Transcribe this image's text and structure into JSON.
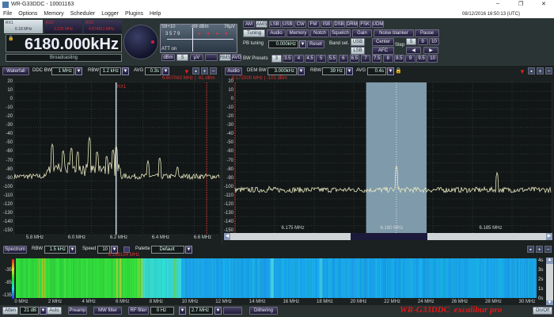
{
  "window": {
    "title": "WR-G33DDC - 10001163",
    "datetime": "08/12/2016 16:50:13 (UTC)",
    "minimize": "–",
    "restore": "❐",
    "close": "✕"
  },
  "menu": [
    "File",
    "Options",
    "Memory",
    "Scheduler",
    "Logger",
    "Plugins",
    "Help"
  ],
  "receivers": [
    {
      "label": "RX1",
      "freq": "6.18 MHz"
    },
    {
      "label": "RX2",
      "freq": "3.225 MHz"
    },
    {
      "label": "RX3",
      "freq": "4.874611 MHz"
    }
  ],
  "frequency_display": "6180.000kHz",
  "station_label": "Broadcasting",
  "smeter": {
    "left": "S9+10",
    "center": "-69 dBm",
    "right": "76µV",
    "scale": "3 5 7 9",
    "att": "ATT on",
    "units": [
      "dBm",
      "S",
      "µV",
      "",
      "RMS",
      "AVG"
    ],
    "active_units": [
      "S",
      "RMS"
    ]
  },
  "modes": [
    "AM",
    "AMS",
    "LSB",
    "USB",
    "CW",
    "FM",
    "ISB",
    "DSB",
    "DRM",
    "FSK",
    "UDM"
  ],
  "active_mode": "AMS",
  "tabs": [
    "Tuning",
    "Audio",
    "Memory",
    "Notch",
    "Squelch",
    "Gain",
    "Noise blanker",
    "Pause"
  ],
  "active_tab": "Tuning",
  "tuning": {
    "pb_label": "PB tuning",
    "pb_value": "0.000kHz",
    "reset": "Reset",
    "band_sel": "Band sel.",
    "usb": "USB",
    "lsb": "LSB",
    "center": "Center",
    "afc": "AFC",
    "step_label": "Step",
    "steps": [
      "5",
      "9",
      "10"
    ],
    "active_step": "5",
    "bw_label": "BW Presets",
    "bw_presets": [
      "3",
      "3.5",
      "4",
      "4.5",
      "5",
      "5.5",
      "6",
      "6.5",
      "7",
      "7.5",
      "8",
      "8.5",
      "9",
      "9.5",
      "10"
    ],
    "active_bw": "3"
  },
  "ddc_panel": {
    "button": "Waterfall",
    "ddc_bw_label": "DDC BW",
    "ddc_bw": "1 MHz",
    "rbw_label": "RBW",
    "rbw": "1.2 kHz",
    "avg_label": "AVG",
    "avg": "0.3s",
    "cursor_readout": "6.607083 MHz | -91 dBm",
    "marker": "RX1",
    "y_ticks": [
      "20",
      "10",
      "0",
      "-10",
      "-20",
      "-30",
      "-40",
      "-50",
      "-60",
      "-70",
      "-80",
      "-90",
      "-100",
      "-110",
      "-120",
      "-130",
      "-140",
      "-150"
    ],
    "x_ticks": [
      "5.8 MHz",
      "6.0 MHz",
      "6.2 MHz",
      "6.4 MHz",
      "6.6 MHz"
    ]
  },
  "audio_panel": {
    "button": "Audio",
    "dem_bw_label": "DEM BW",
    "dem_bw": "3.000kHz",
    "rbw_label": "RBW",
    "rbw": "39 Hz",
    "avg_label": "AVG",
    "avg": "0.4s",
    "cursor_readout": "6.172000 MHz | -101 dBm",
    "x_ticks": [
      "6.175 MHz",
      "6.180 MHz",
      "6.185 MHz"
    ]
  },
  "waterfall": {
    "button": "Spectrum",
    "rbw_label": "RBW",
    "rbw": "1.5 kHz",
    "speed_label": "Speed",
    "speed": "10",
    "palette_label": "Palette",
    "palette": "Default",
    "cursor_readout": "6.169154 MHz",
    "y_ticks": [
      "-35",
      "-85",
      "-135"
    ],
    "time_ticks": [
      "4s",
      "3s",
      "2s",
      "1s",
      "0s"
    ],
    "x_ticks": [
      "0 MHz",
      "2 MHz",
      "4 MHz",
      "6 MHz",
      "8 MHz",
      "10 MHz",
      "12 MHz",
      "14 MHz",
      "16 MHz",
      "18 MHz",
      "20 MHz",
      "22 MHz",
      "24 MHz",
      "26 MHz",
      "28 MHz",
      "30 MHz"
    ]
  },
  "bottom": {
    "atten": "Atten",
    "atten_value": "21 dB",
    "auto": "Auto",
    "preamp": "Preamp",
    "mw_filter": "MW filter",
    "rf_filter": "RF filter",
    "rf_lo": "0 Hz",
    "rf_hi": "2.7 MHz",
    "dithering": "Dithering",
    "logo": "WR-G33DDC  excalibur pro",
    "onoff": "On/Off"
  },
  "chart_data": [
    {
      "type": "line",
      "title": "",
      "xlim": [
        5.7,
        6.67
      ],
      "ylim": [
        -150,
        20
      ],
      "noise_floor_dbm": -85,
      "peaks": [
        {
          "x": 5.88,
          "y": -48
        },
        {
          "x": 5.93,
          "y": -55
        },
        {
          "x": 5.97,
          "y": -52
        },
        {
          "x": 6.0,
          "y": -56
        },
        {
          "x": 6.055,
          "y": -41
        },
        {
          "x": 6.09,
          "y": -56
        },
        {
          "x": 6.135,
          "y": -61
        },
        {
          "x": 6.165,
          "y": -54
        },
        {
          "x": 6.18,
          "y": -50
        },
        {
          "x": 6.33,
          "y": -67
        },
        {
          "x": 6.385,
          "y": -63
        },
        {
          "x": 6.47,
          "y": -73
        }
      ],
      "color": "#e8e8c0"
    },
    {
      "type": "line",
      "title": "",
      "xlim": [
        6.172,
        6.1877
      ],
      "ylim": [
        -150,
        20
      ],
      "noise_floor_dbm": -100,
      "peaks": [
        {
          "x": 6.1737,
          "y": -95
        },
        {
          "x": 6.18,
          "y": -73
        },
        {
          "x": 6.185,
          "y": -80
        }
      ],
      "color": "#e8e8c0"
    }
  ]
}
